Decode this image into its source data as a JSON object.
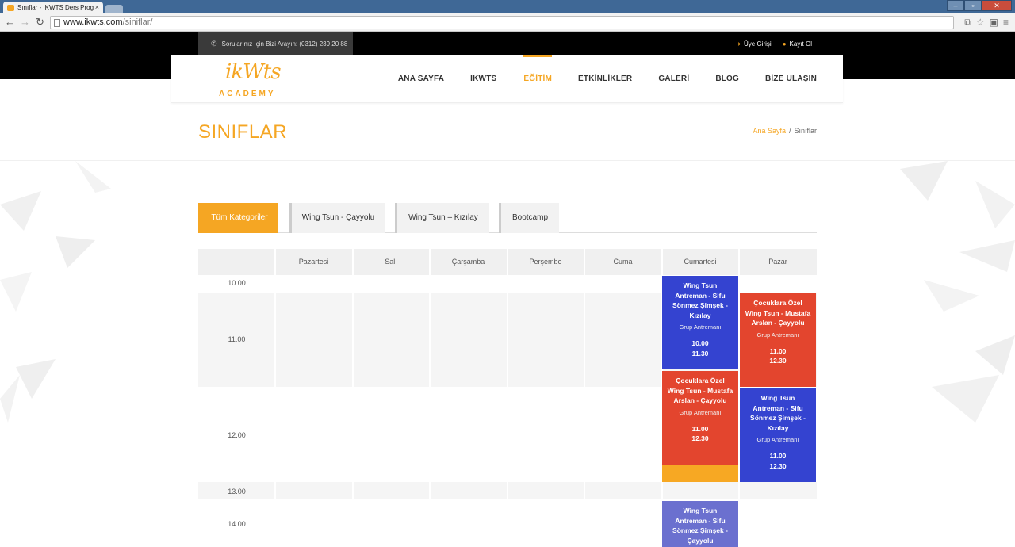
{
  "browser": {
    "tab_title": "Sınıflar - IKWTS Ders Prog",
    "url_host": "www.ikwts.com",
    "url_path": "/siniflar/"
  },
  "topbar": {
    "phone_text": "Sorularınız İçin Bizi Arayın: (0312) 239 20 88",
    "login": "Üye Girişi",
    "register": "Kayıt Ol"
  },
  "logo": {
    "mark": "ikWts",
    "sub": "ACADEMY"
  },
  "nav": {
    "items": [
      "ANA SAYFA",
      "IKWTS",
      "EĞİTİM",
      "ETKİNLİKLER",
      "GALERİ",
      "BLOG",
      "BİZE ULAŞIN"
    ],
    "active": "EĞİTİM"
  },
  "page": {
    "title": "SINIFLAR",
    "breadcrumb": {
      "home": "Ana Sayfa",
      "separator": "/",
      "current": "Sınıflar"
    }
  },
  "filters": [
    "Tüm Kategoriler",
    "Wing Tsun - Çayyolu",
    "Wing Tsun – Kızılay",
    "Bootcamp"
  ],
  "timetable": {
    "days": [
      "Pazartesi",
      "Salı",
      "Çarşamba",
      "Perşembe",
      "Cuma",
      "Cumartesi",
      "Pazar"
    ],
    "hours": [
      "10.00",
      "11.00",
      "12.00",
      "13.00",
      "14.00"
    ],
    "events": [
      {
        "day": "Cumartesi",
        "title": "Wing Tsun Antreman - Sifu Sönmez Şimşek - Kızılay",
        "category": "Grup Antremanı",
        "start": "10.00",
        "end": "11.30",
        "color": "#3443d0"
      },
      {
        "day": "Pazar",
        "title": "Çocuklara Özel Wing Tsun - Mustafa Arslan - Çayyolu",
        "category": "Grup Antremanı",
        "start": "11.00",
        "end": "12.30",
        "color": "#e3452e"
      },
      {
        "day": "Cumartesi",
        "title": "Çocuklara Özel Wing Tsun - Mustafa Arslan - Çayyolu",
        "category": "Grup Antremanı",
        "start": "11.00",
        "end": "12.30",
        "color": "#e3452e"
      },
      {
        "day": "Pazar",
        "title": "Wing Tsun Antreman - Sifu Sönmez Şimşek - Kızılay",
        "category": "Grup Antremanı",
        "start": "11.00",
        "end": "12.30",
        "color": "#3443d0"
      },
      {
        "day": "Cumartesi",
        "title": "Wing Tsun Antreman - Sifu Sönmez Şimşek - Çayyolu",
        "color": "#6b70cf"
      }
    ]
  },
  "colors": {
    "accent": "#f5a623",
    "event_blue": "#3443d0",
    "event_red": "#e3452e",
    "event_lavender": "#6b70cf"
  }
}
